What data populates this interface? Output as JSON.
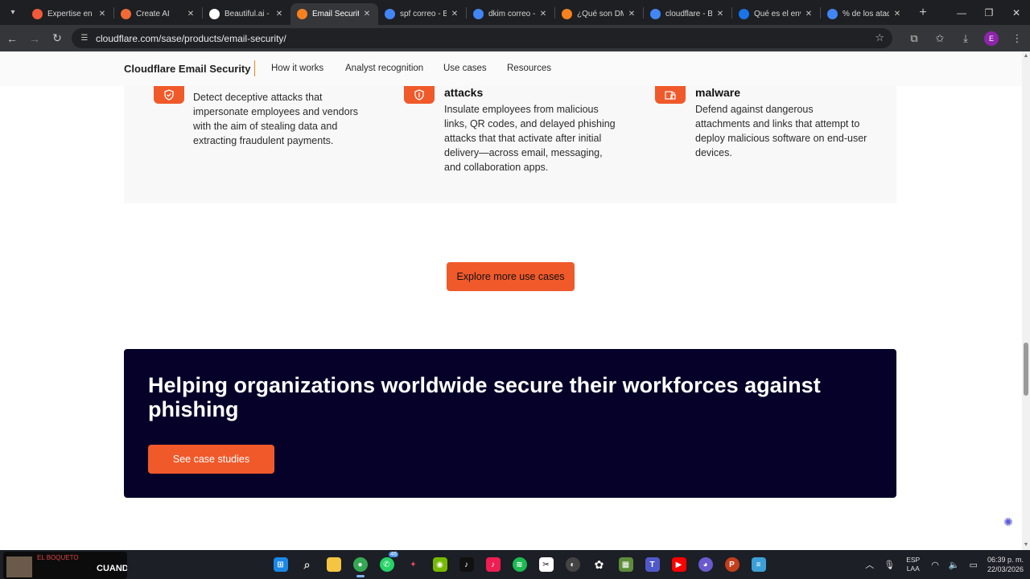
{
  "browser": {
    "tabs": [
      {
        "label": "Expertise en s",
        "favicon": "asterisk-favicon",
        "color": "#f05a3a",
        "active": false
      },
      {
        "label": "Create AI",
        "favicon": "ring-favicon",
        "color": "#f06a35",
        "active": false
      },
      {
        "label": "Beautiful.ai -",
        "favicon": "b-favicon",
        "color": "#ffffff",
        "active": false
      },
      {
        "label": "Email Security",
        "favicon": "cloudflare-favicon",
        "color": "#f6821f",
        "active": true
      },
      {
        "label": "spf correo - B",
        "favicon": "google-favicon",
        "color": "#4285f4",
        "active": false
      },
      {
        "label": "dkim correo -",
        "favicon": "google-favicon",
        "color": "#4285f4",
        "active": false
      },
      {
        "label": "¿Qué son DM",
        "favicon": "cloudflare-favicon",
        "color": "#f6821f",
        "active": false
      },
      {
        "label": "cloudflare - B",
        "favicon": "google-favicon",
        "color": "#4285f4",
        "active": false
      },
      {
        "label": "Qué es el env",
        "favicon": "mountain-favicon",
        "color": "#1a73e8",
        "active": false
      },
      {
        "label": "% de los ataq",
        "favicon": "google-favicon",
        "color": "#4285f4",
        "active": false
      }
    ],
    "url": "cloudflare.com/sase/products/email-security/",
    "profile_initial": "E"
  },
  "subnav": {
    "brand": "Cloudflare Email Security",
    "links": [
      "How it works",
      "Analyst recognition",
      "Use cases",
      "Resources"
    ]
  },
  "features": [
    {
      "title": "",
      "icon": "shield-check-icon",
      "description": "Detect deceptive attacks that impersonate employees and vendors with the aim of stealing data and extracting fraudulent payments."
    },
    {
      "title": "attacks",
      "icon": "shield-link-icon",
      "description": "Insulate employees from malicious links, QR codes, and delayed phishing attacks that that activate after initial delivery—across email, messaging, and collaboration apps."
    },
    {
      "title": "malware",
      "icon": "attachment-lock-icon",
      "description": "Defend against dangerous attachments and links that attempt to deploy malicious software on end-user devices."
    }
  ],
  "cta": {
    "explore_label": "Explore more use cases"
  },
  "banner": {
    "heading": "Helping organizations worldwide secure their workforces against phishing",
    "button_label": "See case studies"
  },
  "taskbar": {
    "thumbnail_caption": "CUANDO",
    "thumbnail_channel": "EL BOQUETO",
    "whatsapp_badge": "46",
    "language": "ESP",
    "language_sub": "LAA",
    "time": "06:39 p. m.",
    "date": "22/03/2026"
  },
  "colors": {
    "accent": "#f0592a",
    "banner_bg": "#050128",
    "brand_line": "#f6821f"
  }
}
